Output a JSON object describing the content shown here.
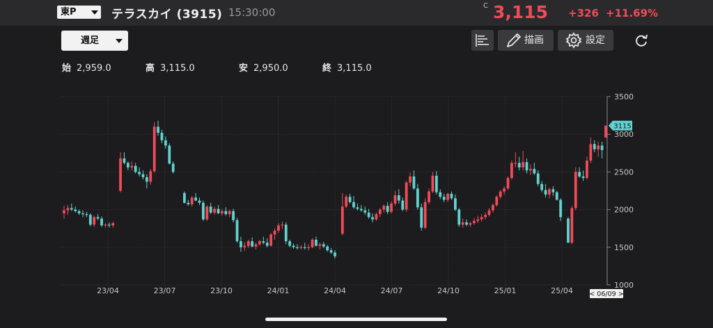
{
  "header": {
    "market": "東P",
    "stock_name": "テラスカイ (3915)",
    "time": "15:30:00",
    "c_mark": "C",
    "price": "3,115",
    "change": "+326",
    "change_pct": "+11.69%"
  },
  "toolbar": {
    "period": "週足",
    "draw_label": "描画",
    "settings_label": "設定",
    "icons": [
      "indicator-list-icon",
      "pencil-icon",
      "gear-icon",
      "refresh-icon"
    ]
  },
  "ohlc": {
    "open_label": "始",
    "open": "2,959.0",
    "high_label": "高",
    "high": "3,115.0",
    "low_label": "安",
    "low": "2,950.0",
    "close_label": "終",
    "close": "3,115.0"
  },
  "colors": {
    "up": "#f24b58",
    "down": "#62d2cf",
    "grid": "#3a3a3c",
    "bg": "#1c1c1e"
  },
  "chart_data": {
    "type": "candlestick",
    "y_ticks": [
      "3500",
      "3000",
      "2500",
      "2000",
      "1500",
      "1000"
    ],
    "x_ticks": [
      "23/04",
      "23/07",
      "23/10",
      "24/01",
      "24/04",
      "24/07",
      "24/10",
      "25/01",
      "25/04"
    ],
    "ylim": [
      1000,
      3500
    ],
    "last_price_label": "3115",
    "date_label": "< 06/09 >",
    "candles": [
      [
        1950,
        2050,
        1880,
        1990
      ],
      [
        1990,
        2060,
        1930,
        2020
      ],
      [
        2020,
        2080,
        1980,
        2000
      ],
      [
        2000,
        2040,
        1960,
        1980
      ],
      [
        1980,
        2000,
        1930,
        1950
      ],
      [
        1950,
        1990,
        1900,
        1940
      ],
      [
        1940,
        1970,
        1900,
        1930
      ],
      [
        1930,
        1950,
        1780,
        1800
      ],
      [
        1800,
        1920,
        1770,
        1900
      ],
      [
        1900,
        1940,
        1860,
        1880
      ],
      [
        1880,
        1910,
        1770,
        1790
      ],
      [
        1790,
        1820,
        1760,
        1800
      ],
      [
        1800,
        1830,
        1760,
        1790
      ],
      [
        1790,
        1840,
        1760,
        1820
      ],
      [
        null,
        null,
        null,
        null
      ],
      [
        2250,
        2760,
        2230,
        2680
      ],
      [
        2680,
        2760,
        2600,
        2620
      ],
      [
        2620,
        2640,
        2520,
        2560
      ],
      [
        2560,
        2640,
        2520,
        2580
      ],
      [
        2580,
        2620,
        2480,
        2500
      ],
      [
        2500,
        2560,
        2440,
        2470
      ],
      [
        2470,
        2520,
        2400,
        2430
      ],
      [
        2430,
        2470,
        2280,
        2370
      ],
      [
        2370,
        2540,
        2330,
        2510
      ],
      [
        2510,
        3160,
        2490,
        3100
      ],
      [
        3100,
        3180,
        2980,
        3020
      ],
      [
        3020,
        3060,
        2880,
        2920
      ],
      [
        2920,
        2970,
        2810,
        2850
      ],
      [
        2850,
        2880,
        2600,
        2610
      ],
      [
        2610,
        2640,
        2480,
        2500
      ],
      [
        null,
        null,
        null,
        null
      ],
      [
        null,
        null,
        null,
        null
      ],
      [
        2220,
        2240,
        2080,
        2090
      ],
      [
        2090,
        2130,
        2050,
        2070
      ],
      [
        2070,
        2180,
        2040,
        2160
      ],
      [
        2160,
        2220,
        2110,
        2120
      ],
      [
        2120,
        2160,
        2060,
        2090
      ],
      [
        2090,
        2120,
        1850,
        1870
      ],
      [
        1870,
        2060,
        1850,
        2040
      ],
      [
        2040,
        2090,
        1940,
        1960
      ],
      [
        1960,
        2040,
        1930,
        2010
      ],
      [
        2010,
        2060,
        1940,
        1950
      ],
      [
        1950,
        2010,
        1920,
        1980
      ],
      [
        1980,
        2030,
        1920,
        1940
      ],
      [
        1940,
        2000,
        1900,
        1980
      ],
      [
        1980,
        2010,
        1830,
        1860
      ],
      [
        1860,
        1890,
        1560,
        1580
      ],
      [
        1580,
        1640,
        1440,
        1500
      ],
      [
        1500,
        1570,
        1450,
        1520
      ],
      [
        1520,
        1600,
        1490,
        1580
      ],
      [
        1580,
        1630,
        1500,
        1510
      ],
      [
        1510,
        1560,
        1470,
        1540
      ],
      [
        1540,
        1600,
        1520,
        1580
      ],
      [
        1580,
        1640,
        1540,
        1560
      ],
      [
        1560,
        1620,
        1500,
        1520
      ],
      [
        1520,
        1690,
        1510,
        1670
      ],
      [
        1670,
        1750,
        1600,
        1720
      ],
      [
        1720,
        1820,
        1690,
        1790
      ],
      [
        1790,
        1840,
        1740,
        1800
      ],
      [
        1800,
        1830,
        1540,
        1580
      ],
      [
        1580,
        1600,
        1500,
        1520
      ],
      [
        1520,
        1550,
        1480,
        1500
      ],
      [
        1500,
        1540,
        1470,
        1490
      ],
      [
        1490,
        1530,
        1470,
        1500
      ],
      [
        1500,
        1560,
        1470,
        1490
      ],
      [
        1490,
        1540,
        1460,
        1500
      ],
      [
        1500,
        1620,
        1490,
        1600
      ],
      [
        1600,
        1640,
        1510,
        1520
      ],
      [
        1520,
        1560,
        1470,
        1540
      ],
      [
        1540,
        1570,
        1490,
        1510
      ],
      [
        1510,
        1530,
        1440,
        1460
      ],
      [
        1460,
        1490,
        1410,
        1430
      ],
      [
        1430,
        1460,
        1350,
        1380
      ],
      [
        null,
        null,
        null,
        null
      ],
      [
        1680,
        2220,
        1660,
        2040
      ],
      [
        2040,
        2200,
        2020,
        2170
      ],
      [
        2170,
        2210,
        2080,
        2100
      ],
      [
        2100,
        2180,
        2010,
        2030
      ],
      [
        2030,
        2080,
        1990,
        2010
      ],
      [
        2010,
        2060,
        1970,
        1990
      ],
      [
        1990,
        2040,
        1930,
        1960
      ],
      [
        1960,
        2010,
        1880,
        1900
      ],
      [
        1900,
        1950,
        1830,
        1870
      ],
      [
        1870,
        1960,
        1850,
        1940
      ],
      [
        1940,
        2020,
        1900,
        2000
      ],
      [
        2000,
        2070,
        1960,
        2050
      ],
      [
        2050,
        2100,
        1940,
        1970
      ],
      [
        1970,
        2110,
        1950,
        2080
      ],
      [
        2080,
        2250,
        2050,
        2190
      ],
      [
        2190,
        2270,
        2080,
        2120
      ],
      [
        2120,
        2160,
        1980,
        2000
      ],
      [
        2000,
        2380,
        1970,
        2360
      ],
      [
        2360,
        2490,
        2310,
        2440
      ],
      [
        2440,
        2520,
        2260,
        2280
      ],
      [
        2280,
        2340,
        2000,
        2030
      ],
      [
        2030,
        2080,
        1720,
        1760
      ],
      [
        1760,
        2150,
        1740,
        2100
      ],
      [
        2100,
        2280,
        2070,
        2240
      ],
      [
        2240,
        2500,
        2220,
        2450
      ],
      [
        2450,
        2510,
        2200,
        2230
      ],
      [
        2230,
        2270,
        2140,
        2170
      ],
      [
        2170,
        2210,
        2100,
        2130
      ],
      [
        2130,
        2220,
        2100,
        2210
      ],
      [
        2210,
        2240,
        2130,
        2150
      ],
      [
        2150,
        2200,
        1980,
        2000
      ],
      [
        2000,
        2020,
        1770,
        1800
      ],
      [
        1800,
        1880,
        1760,
        1830
      ],
      [
        1830,
        1870,
        1780,
        1800
      ],
      [
        1800,
        1840,
        1770,
        1820
      ],
      [
        1820,
        1890,
        1800,
        1850
      ],
      [
        1850,
        1920,
        1820,
        1870
      ],
      [
        1870,
        1940,
        1840,
        1900
      ],
      [
        1900,
        1960,
        1870,
        1930
      ],
      [
        1930,
        2020,
        1910,
        1990
      ],
      [
        1990,
        2080,
        1960,
        2060
      ],
      [
        2060,
        2190,
        2040,
        2170
      ],
      [
        2170,
        2260,
        2140,
        2240
      ],
      [
        2240,
        2310,
        2200,
        2280
      ],
      [
        2280,
        2440,
        2260,
        2420
      ],
      [
        2420,
        2650,
        2400,
        2620
      ],
      [
        2620,
        2760,
        2560,
        2620
      ],
      [
        2620,
        2700,
        2520,
        2560
      ],
      [
        2560,
        2780,
        2520,
        2630
      ],
      [
        2630,
        2680,
        2480,
        2520
      ],
      [
        2520,
        2600,
        2460,
        2540
      ],
      [
        2540,
        2620,
        2460,
        2480
      ],
      [
        2480,
        2520,
        2310,
        2340
      ],
      [
        2340,
        2380,
        2230,
        2260
      ],
      [
        2260,
        2340,
        2160,
        2200
      ],
      [
        2200,
        2290,
        2150,
        2270
      ],
      [
        2270,
        2310,
        2180,
        2230
      ],
      [
        2230,
        2250,
        2120,
        2130
      ],
      [
        2130,
        2150,
        1850,
        1900
      ],
      [
        null,
        null,
        null,
        null
      ],
      [
        1880,
        1900,
        1560,
        1560
      ],
      [
        1560,
        2050,
        1540,
        2020
      ],
      [
        2020,
        2560,
        1990,
        2500
      ],
      [
        2500,
        2560,
        2420,
        2440
      ],
      [
        2440,
        2520,
        2380,
        2420
      ],
      [
        2420,
        2700,
        2400,
        2650
      ],
      [
        2650,
        2960,
        2620,
        2870
      ],
      [
        2870,
        2920,
        2760,
        2800
      ],
      [
        2800,
        2900,
        2700,
        2850
      ],
      [
        2850,
        2900,
        2680,
        2790
      ],
      [
        2959,
        3115,
        2950,
        3115
      ]
    ]
  }
}
